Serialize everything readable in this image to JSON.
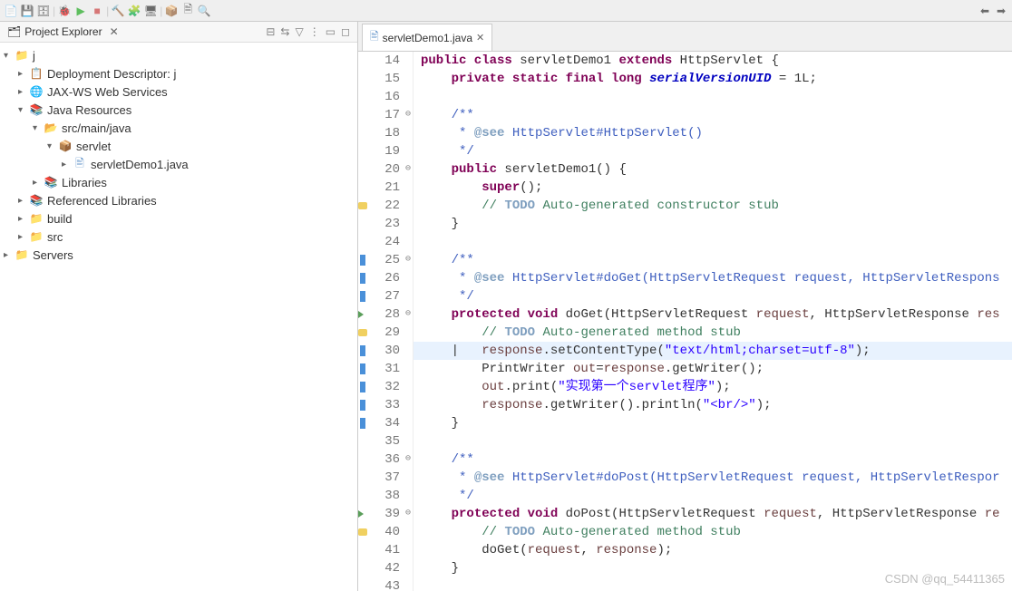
{
  "toolbar": {
    "icons": [
      "new",
      "save",
      "saveall",
      "print",
      "debug",
      "skip",
      "build",
      "run-dd",
      "debug-dd",
      "ext",
      "run",
      "coverage",
      "profile",
      "stop",
      "server",
      "add",
      "wizard",
      "search",
      "open",
      "new-pkg",
      "refresh",
      "filter",
      "pin",
      "sync",
      "back",
      "fwd"
    ]
  },
  "explorer": {
    "title": "Project Explorer",
    "nodes": [
      {
        "indent": 0,
        "arrow": "▾",
        "icon": "proj",
        "label": "j"
      },
      {
        "indent": 1,
        "arrow": "▸",
        "icon": "desc",
        "label": "Deployment Descriptor: j"
      },
      {
        "indent": 1,
        "arrow": "▸",
        "icon": "jax",
        "label": "JAX-WS Web Services"
      },
      {
        "indent": 1,
        "arrow": "▾",
        "icon": "javares",
        "label": "Java Resources"
      },
      {
        "indent": 2,
        "arrow": "▾",
        "icon": "srcfolder",
        "label": "src/main/java"
      },
      {
        "indent": 3,
        "arrow": "▾",
        "icon": "pkg",
        "label": "servlet"
      },
      {
        "indent": 4,
        "arrow": "▸",
        "icon": "java",
        "label": "servletDemo1.java"
      },
      {
        "indent": 2,
        "arrow": "▸",
        "icon": "lib",
        "label": "Libraries"
      },
      {
        "indent": 1,
        "arrow": "▸",
        "icon": "lib",
        "label": "Referenced Libraries"
      },
      {
        "indent": 1,
        "arrow": "▸",
        "icon": "folder",
        "label": "build"
      },
      {
        "indent": 1,
        "arrow": "▸",
        "icon": "folder",
        "label": "src"
      },
      {
        "indent": 0,
        "arrow": "▸",
        "icon": "folder",
        "label": "Servers"
      }
    ]
  },
  "editor": {
    "tab_title": "servletDemo1.java",
    "lines": [
      {
        "n": 14,
        "fold": "",
        "mk": "",
        "tokens": [
          [
            "kw",
            "public class"
          ],
          [
            "",
            " "
          ],
          [
            "",
            "servletDemo1 "
          ],
          [
            "kw",
            "extends"
          ],
          [
            "",
            " HttpServlet {"
          ]
        ]
      },
      {
        "n": 15,
        "fold": "",
        "mk": "",
        "tokens": [
          [
            "",
            "    "
          ],
          [
            "kw",
            "private static final long"
          ],
          [
            "",
            " "
          ],
          [
            "field",
            "serialVersionUID"
          ],
          [
            "",
            " = 1L;"
          ]
        ]
      },
      {
        "n": 16,
        "fold": "",
        "mk": "",
        "tokens": [
          [
            "",
            ""
          ]
        ]
      },
      {
        "n": 17,
        "fold": "⊖",
        "mk": "",
        "tokens": [
          [
            "",
            "    "
          ],
          [
            "jdlink",
            "/**"
          ]
        ]
      },
      {
        "n": 18,
        "fold": "",
        "mk": "",
        "tokens": [
          [
            "",
            "     "
          ],
          [
            "jdlink",
            "* "
          ],
          [
            "jdtag",
            "@see"
          ],
          [
            "jdlink",
            " HttpServlet#HttpServlet()"
          ]
        ]
      },
      {
        "n": 19,
        "fold": "",
        "mk": "",
        "tokens": [
          [
            "",
            "     "
          ],
          [
            "jdlink",
            "*/"
          ]
        ]
      },
      {
        "n": 20,
        "fold": "⊖",
        "mk": "",
        "tokens": [
          [
            "",
            "    "
          ],
          [
            "kw",
            "public"
          ],
          [
            "",
            " servletDemo1() {"
          ]
        ]
      },
      {
        "n": 21,
        "fold": "",
        "mk": "",
        "tokens": [
          [
            "",
            "        "
          ],
          [
            "kw",
            "super"
          ],
          [
            "",
            "();"
          ]
        ]
      },
      {
        "n": 22,
        "fold": "",
        "mk": "yellow",
        "tokens": [
          [
            "",
            "        "
          ],
          [
            "com",
            "// "
          ],
          [
            "todo",
            "TODO"
          ],
          [
            "com",
            " Auto-generated constructor stub"
          ]
        ]
      },
      {
        "n": 23,
        "fold": "",
        "mk": "",
        "tokens": [
          [
            "",
            "    }"
          ]
        ]
      },
      {
        "n": 24,
        "fold": "",
        "mk": "",
        "tokens": [
          [
            "",
            ""
          ]
        ]
      },
      {
        "n": 25,
        "fold": "⊖",
        "mk": "blue",
        "tokens": [
          [
            "",
            "    "
          ],
          [
            "jdlink",
            "/**"
          ]
        ]
      },
      {
        "n": 26,
        "fold": "",
        "mk": "blue",
        "tokens": [
          [
            "",
            "     "
          ],
          [
            "jdlink",
            "* "
          ],
          [
            "jdtag",
            "@see"
          ],
          [
            "jdlink",
            " HttpServlet#doGet(HttpServletRequest request, HttpServletRespons"
          ]
        ]
      },
      {
        "n": 27,
        "fold": "",
        "mk": "blue",
        "tokens": [
          [
            "",
            "     "
          ],
          [
            "jdlink",
            "*/"
          ]
        ]
      },
      {
        "n": 28,
        "fold": "⊖",
        "mk": "green",
        "tokens": [
          [
            "",
            "    "
          ],
          [
            "kw",
            "protected void"
          ],
          [
            "",
            " doGet(HttpServletRequest "
          ],
          [
            "var",
            "request"
          ],
          [
            "",
            ", HttpServletResponse "
          ],
          [
            "var",
            "res"
          ]
        ]
      },
      {
        "n": 29,
        "fold": "",
        "mk": "yellow",
        "tokens": [
          [
            "",
            "        "
          ],
          [
            "com",
            "// "
          ],
          [
            "todo",
            "TODO"
          ],
          [
            "com",
            " Auto-generated method stub"
          ]
        ]
      },
      {
        "n": 30,
        "fold": "",
        "mk": "blue",
        "hl": true,
        "tokens": [
          [
            "",
            "    |   "
          ],
          [
            "var",
            "response"
          ],
          [
            "",
            ".setContentType("
          ],
          [
            "str",
            "\"text/html;charset=utf-8\""
          ],
          [
            "",
            ");"
          ]
        ]
      },
      {
        "n": 31,
        "fold": "",
        "mk": "blue",
        "tokens": [
          [
            "",
            "        PrintWriter "
          ],
          [
            "var",
            "out"
          ],
          [
            "",
            "="
          ],
          [
            "var",
            "response"
          ],
          [
            "",
            ".getWriter();"
          ]
        ]
      },
      {
        "n": 32,
        "fold": "",
        "mk": "blue",
        "tokens": [
          [
            "",
            "        "
          ],
          [
            "var",
            "out"
          ],
          [
            "",
            ".print("
          ],
          [
            "str",
            "\"实现第一个servlet程序\""
          ],
          [
            "",
            ");"
          ]
        ]
      },
      {
        "n": 33,
        "fold": "",
        "mk": "blue",
        "tokens": [
          [
            "",
            "        "
          ],
          [
            "var",
            "response"
          ],
          [
            "",
            ".getWriter().println("
          ],
          [
            "str",
            "\"<br/>\""
          ],
          [
            "",
            ");"
          ]
        ]
      },
      {
        "n": 34,
        "fold": "",
        "mk": "blue",
        "tokens": [
          [
            "",
            "    }"
          ]
        ]
      },
      {
        "n": 35,
        "fold": "",
        "mk": "",
        "tokens": [
          [
            "",
            ""
          ]
        ]
      },
      {
        "n": 36,
        "fold": "⊖",
        "mk": "",
        "tokens": [
          [
            "",
            "    "
          ],
          [
            "jdlink",
            "/**"
          ]
        ]
      },
      {
        "n": 37,
        "fold": "",
        "mk": "",
        "tokens": [
          [
            "",
            "     "
          ],
          [
            "jdlink",
            "* "
          ],
          [
            "jdtag",
            "@see"
          ],
          [
            "jdlink",
            " HttpServlet#doPost(HttpServletRequest request, HttpServletRespor"
          ]
        ]
      },
      {
        "n": 38,
        "fold": "",
        "mk": "",
        "tokens": [
          [
            "",
            "     "
          ],
          [
            "jdlink",
            "*/"
          ]
        ]
      },
      {
        "n": 39,
        "fold": "⊖",
        "mk": "green",
        "tokens": [
          [
            "",
            "    "
          ],
          [
            "kw",
            "protected void"
          ],
          [
            "",
            " doPost(HttpServletRequest "
          ],
          [
            "var",
            "request"
          ],
          [
            "",
            ", HttpServletResponse "
          ],
          [
            "var",
            "re"
          ]
        ]
      },
      {
        "n": 40,
        "fold": "",
        "mk": "yellow",
        "tokens": [
          [
            "",
            "        "
          ],
          [
            "com",
            "// "
          ],
          [
            "todo",
            "TODO"
          ],
          [
            "com",
            " Auto-generated method stub"
          ]
        ]
      },
      {
        "n": 41,
        "fold": "",
        "mk": "",
        "tokens": [
          [
            "",
            "        doGet("
          ],
          [
            "var",
            "request"
          ],
          [
            "",
            ", "
          ],
          [
            "var",
            "response"
          ],
          [
            "",
            ");"
          ]
        ]
      },
      {
        "n": 42,
        "fold": "",
        "mk": "",
        "tokens": [
          [
            "",
            "    }"
          ]
        ]
      },
      {
        "n": 43,
        "fold": "",
        "mk": "",
        "tokens": [
          [
            "",
            ""
          ]
        ]
      }
    ]
  },
  "watermark": "CSDN @qq_54411365"
}
